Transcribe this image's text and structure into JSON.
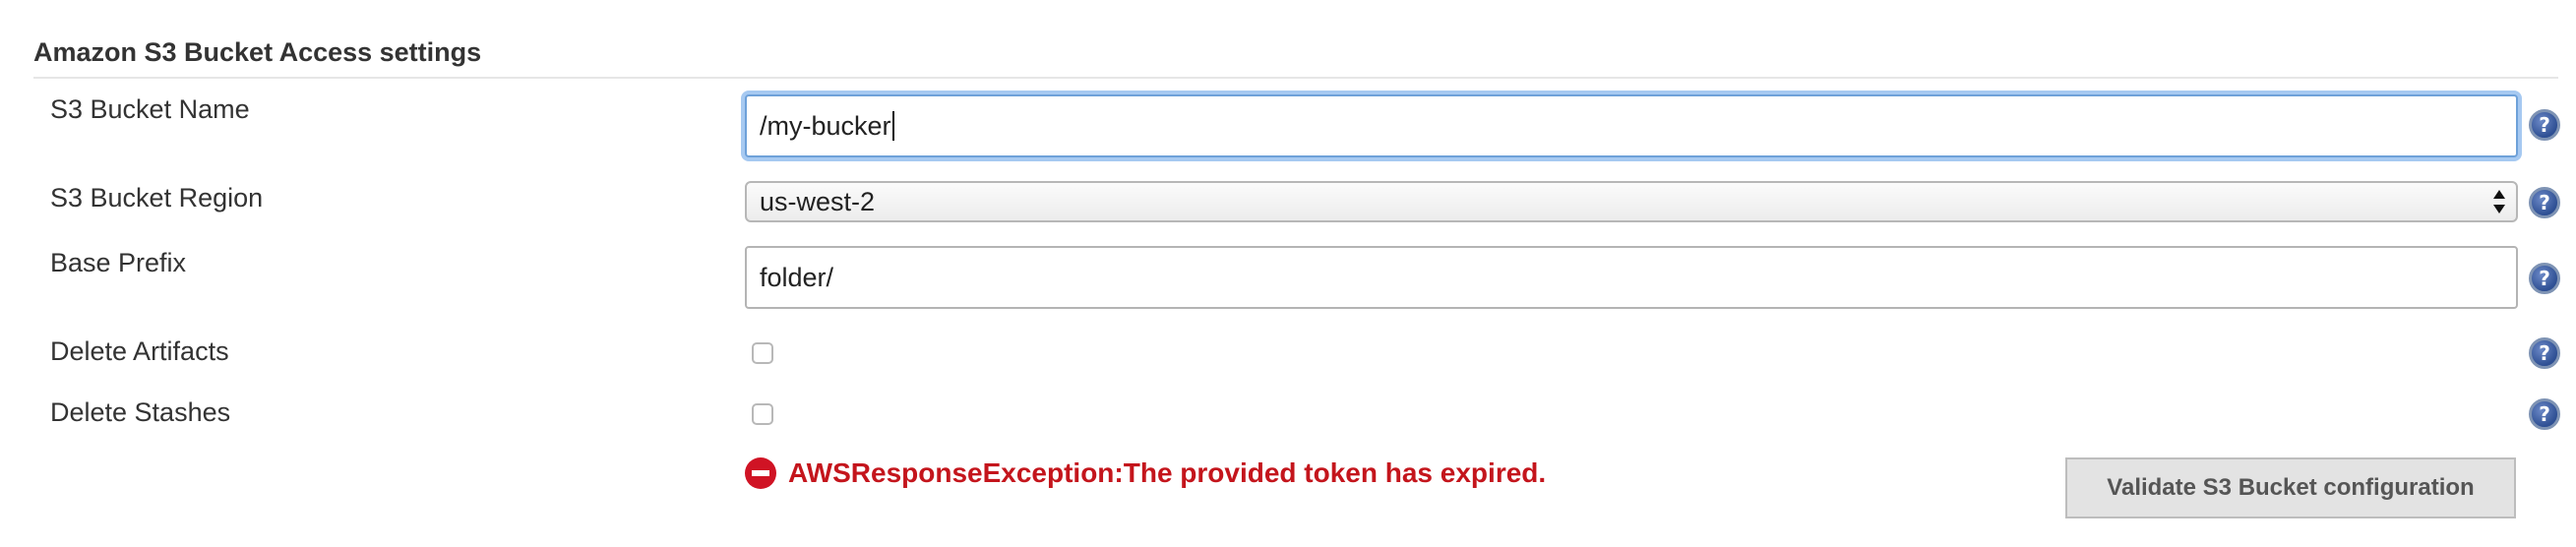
{
  "section": {
    "title": "Amazon S3 Bucket Access settings"
  },
  "fields": {
    "bucket_name": {
      "label": "S3 Bucket Name",
      "value": "/my-bucker"
    },
    "bucket_region": {
      "label": "S3 Bucket Region",
      "value": "us-west-2"
    },
    "base_prefix": {
      "label": "Base Prefix",
      "value": "folder/"
    },
    "delete_artifacts": {
      "label": "Delete Artifacts",
      "checked": false
    },
    "delete_stashes": {
      "label": "Delete Stashes",
      "checked": false
    }
  },
  "help": {
    "glyph": "?"
  },
  "validation": {
    "error_message": "AWSResponseException:The provided token has expired.",
    "button_label": "Validate S3 Bucket configuration"
  },
  "colors": {
    "error": "#c4151c",
    "focus": "#6ea1d9",
    "help_icon": "#3a5a9c"
  }
}
